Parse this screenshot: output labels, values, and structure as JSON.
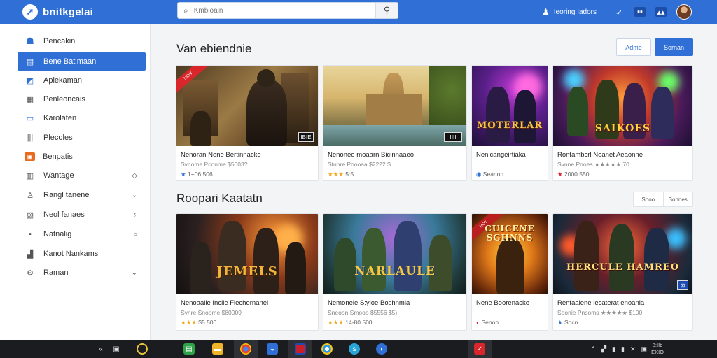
{
  "app": {
    "name": "bnitkgelai"
  },
  "search": {
    "placeholder": "Kmbioain"
  },
  "header": {
    "user_label": "Ieoring Iadors"
  },
  "sidebar": {
    "items": [
      {
        "label": "Pencakin",
        "icon": "person-icon",
        "glyph": "☗"
      },
      {
        "label": "Bene Batimaan",
        "icon": "calendar-icon",
        "glyph": "▤"
      },
      {
        "label": "Apiekaman",
        "icon": "app-icon",
        "glyph": "◩"
      },
      {
        "label": "Penleoncais",
        "icon": "grid-icon",
        "glyph": "▦"
      },
      {
        "label": "Karolaten",
        "icon": "window-icon",
        "glyph": "▭"
      },
      {
        "label": "Plecoles",
        "icon": "columns-icon",
        "glyph": "|||"
      },
      {
        "label": "Benpatis",
        "icon": "gamepad-icon",
        "glyph": "▣"
      },
      {
        "label": "Wantage",
        "icon": "calendar-icon",
        "glyph": "▥",
        "right": "◇"
      },
      {
        "label": "Rangl tanene",
        "icon": "person-outline-icon",
        "glyph": "♙",
        "right": "⌄"
      },
      {
        "label": "Neol fanaes",
        "icon": "image-icon",
        "glyph": "▨",
        "right": "♁"
      },
      {
        "label": "Natnalig",
        "icon": "square-dot-icon",
        "glyph": "▪",
        "right": "○"
      },
      {
        "label": "Kanot Nankams",
        "icon": "bar-chart-icon",
        "glyph": "▟"
      },
      {
        "label": "Raman",
        "icon": "gear-icon",
        "glyph": "⚙",
        "right": "⌄"
      }
    ]
  },
  "sections": [
    {
      "title": "Van ebiendnie",
      "buttons": [
        "Adme",
        "Sornan"
      ]
    },
    {
      "title": "Roopari Kaatatn",
      "segments": [
        "Sooo",
        "Sonnes"
      ]
    }
  ],
  "cards": [
    {
      "title": "Nenoran Nene Bertinnacke",
      "meta": "Svnome Pconme $5003?",
      "rating": "1+06 506",
      "stars": "★",
      "corner": "IBIE"
    },
    {
      "title": "Nenonee moaarn Bicinnaaeo",
      "meta": "Stunre Poooaa $2222 $",
      "rating": "5:5",
      "stars": "★★★"
    },
    {
      "title": "Nenlcangeirtiaka",
      "meta": "",
      "rating": "Seanon",
      "stars": "",
      "art": "MOTERLAR"
    },
    {
      "title": "Ronfambcrl Neanet Aeaonne",
      "meta": "Svnne Pnoes ★★★★★ 70",
      "rating": "2000 550",
      "stars": "★",
      "art": "SAIKOES"
    },
    {
      "title": "Nenoaalle Inclie Fiechernanel",
      "meta": "Svnre Snoome $80009",
      "rating": "$5 500",
      "stars": "★★★",
      "art": "JEMELS"
    },
    {
      "title": "Nemonele S:yloe Boshnmia",
      "meta": "Sneoon Smooo $5556 $5)",
      "rating": "14-80 500",
      "stars": "★★★",
      "art": "NARLAULE"
    },
    {
      "title": "Nene Boorenacke",
      "meta": "",
      "rating": "Senon",
      "stars": "",
      "art": "CUICENE SGHNNS"
    },
    {
      "title": "Renfaalene lecaterat enoania",
      "meta": "Soonie Pnsoms ★★★★★ $100",
      "rating": "Socn",
      "stars": "★",
      "art": "HERCULE HAMREO"
    }
  ]
}
